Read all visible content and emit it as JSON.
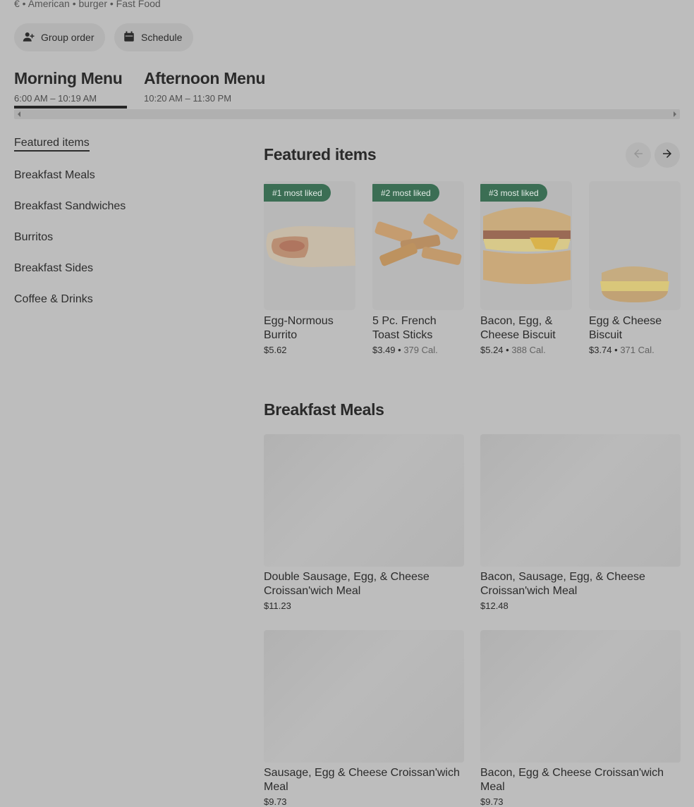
{
  "store": {
    "meta": "€ • American • burger • Fast Food"
  },
  "actions": {
    "group_order": "Group order",
    "schedule": "Schedule"
  },
  "menus": [
    {
      "name": "Morning Menu",
      "hours": "6:00 AM – 10:19 AM"
    },
    {
      "name": "Afternoon Menu",
      "hours": "10:20 AM – 11:30 PM"
    }
  ],
  "sidebar": {
    "items": [
      "Featured items",
      "Breakfast Meals",
      "Breakfast Sandwiches",
      "Burritos",
      "Breakfast Sides",
      "Coffee & Drinks"
    ]
  },
  "featured": {
    "title": "Featured items",
    "items": [
      {
        "badge": "#1 most liked",
        "name": "Egg-Normous Burrito",
        "price": "$5.62",
        "cal": ""
      },
      {
        "badge": "#2 most liked",
        "name": "5 Pc. French Toast Sticks",
        "price": "$3.49",
        "cal": "379 Cal."
      },
      {
        "badge": "#3 most liked",
        "name": "Bacon, Egg, & Cheese Biscuit",
        "price": "$5.24",
        "cal": "388 Cal."
      },
      {
        "badge": "",
        "name": "Egg & Cheese Biscuit",
        "price": "$3.74",
        "cal": "371 Cal."
      }
    ]
  },
  "breakfast_meals": {
    "title": "Breakfast Meals",
    "items": [
      {
        "name": "Double Sausage, Egg, & Cheese Croissan'wich Meal",
        "price": "$11.23"
      },
      {
        "name": "Bacon, Sausage, Egg, & Cheese Croissan'wich Meal",
        "price": "$12.48"
      },
      {
        "name": "Sausage, Egg & Cheese Croissan'wich Meal",
        "price": "$9.73"
      },
      {
        "name": "Bacon, Egg & Cheese Croissan'wich Meal",
        "price": "$9.73"
      }
    ]
  },
  "colors": {
    "overlay_bg": "#bdbdbd",
    "badge_green": "#3b6e54"
  }
}
